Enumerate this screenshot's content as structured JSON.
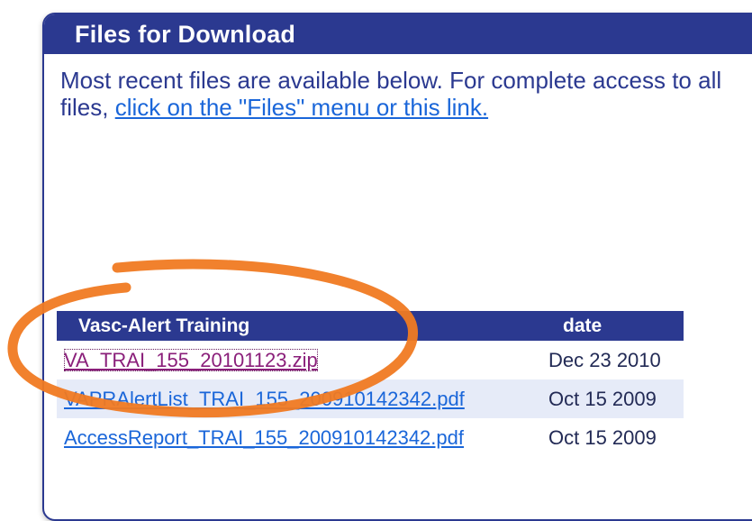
{
  "panel": {
    "title": "Files for Download",
    "intro_text": "Most recent files are available below. For complete access to all files, ",
    "intro_link": "click on the \"Files\" menu or this link."
  },
  "table": {
    "headers": {
      "name": "Vasc-Alert Training",
      "date": "date"
    },
    "rows": [
      {
        "file": "VA_TRAI_155_20101123.zip",
        "date": "Dec 23 2010"
      },
      {
        "file": "VAPRAlertList_TRAI_155_200910142342.pdf",
        "date": "Oct 15 2009"
      },
      {
        "file": "AccessReport_TRAI_155_200910142342.pdf",
        "date": "Oct 15 2009"
      }
    ]
  },
  "colors": {
    "header_bg": "#2b3990",
    "link": "#1a66d9",
    "visited_link": "#8a1f7a",
    "annotation_ring": "#f07a22",
    "alt_row_bg": "#e6ebf8"
  }
}
